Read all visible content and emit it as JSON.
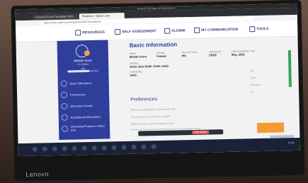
{
  "browser": {
    "window_title": "Search for Apps & Documents",
    "tabs": [
      {
        "label": "Consent Form Candidate Mini...",
        "active": false
      },
      {
        "label": "Students - Naukri.com",
        "active": true
      }
    ],
    "url": "https://www.naukri.com/mnjuser/profile?id=&altresId"
  },
  "nav": {
    "items": [
      {
        "label": "RESOURCES",
        "icon": "document-icon"
      },
      {
        "label": "SELF ASSESSMENT",
        "icon": "clipboard-icon"
      },
      {
        "label": "ALUMNI",
        "icon": "people-icon"
      },
      {
        "label": "MY COMMUNICATION",
        "icon": "chat-icon"
      },
      {
        "label": "TOOLS",
        "icon": "gear-icon"
      }
    ]
  },
  "sidebar": {
    "name": "Mehak Arora",
    "role": "PI Unfilled",
    "progress_percent": 70,
    "menu": [
      {
        "label": "Basic Information"
      },
      {
        "label": "Preferences"
      },
      {
        "label": "Education Details"
      },
      {
        "label": "Educational Information"
      },
      {
        "label": "Internship/Projects & Other Info"
      }
    ]
  },
  "basic": {
    "title": "Basic Information",
    "name_label": "Name",
    "name_value": "Mehak Arora",
    "gender_label": "Gender",
    "gender_value": "Female",
    "class_label": "Current Class",
    "class_value": "9th",
    "board_label": "10th Board",
    "board_value": "CBSE",
    "year_label": "10th Completion Year",
    "year_value": "May, 2022",
    "address_label": "Address",
    "address_value": "Delhi, New Delhi, Delhi, India",
    "citizenship_label": "Citizenship",
    "citizenship_value": "India"
  },
  "preferences": {
    "title": "Preferences",
    "rows": [
      "Will you be applying for need-based aid?",
      "Do you have any countries in mind?",
      "Which of these countries appeal to you?",
      "Preferred course and/or field of study you are passionate about"
    ],
    "answers": [
      "Yes",
      "India",
      "Business",
      "No"
    ]
  },
  "toolbar": {
    "stop_button": "Stop sharing"
  },
  "taskbar": {
    "time": "12:31"
  },
  "brand": "Lenovo"
}
